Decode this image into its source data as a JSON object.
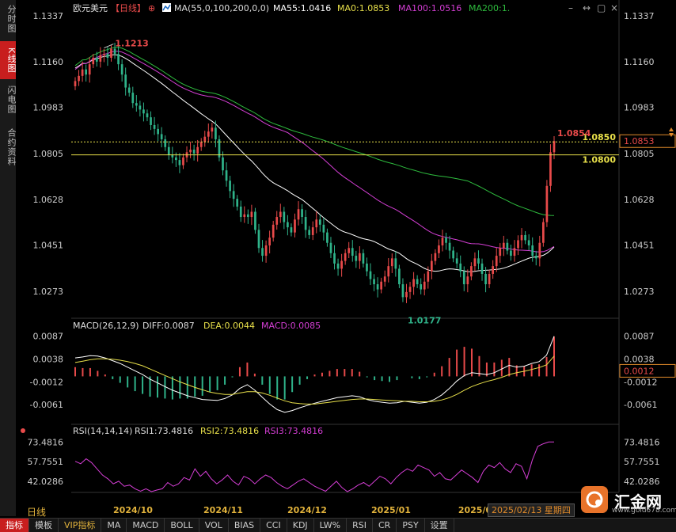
{
  "sidebar": {
    "tabs": [
      {
        "label": "分时图",
        "active": false
      },
      {
        "label": "K线图",
        "active": true
      },
      {
        "label": "闪电图",
        "active": false
      },
      {
        "label": "合约资料",
        "active": false
      }
    ]
  },
  "header": {
    "symbol": "欧元美元",
    "period": "【日线】",
    "settings_icon": "⊕",
    "ma_icon": "chart-icon",
    "ma_spec": "MA(55,0,100,200,0,0)",
    "ma55": "MA55:1.0416",
    "ma0": "MA0:1.0853",
    "ma100": "MA100:1.0516",
    "ma200": "MA200:1."
  },
  "window_controls": [
    "–",
    "↔",
    "▢",
    "×"
  ],
  "colors": {
    "up": "#e84a4a",
    "down": "#2fb38a",
    "ma55": "#ffffff",
    "ma100": "#d43ed4",
    "ma200": "#2ebc3e",
    "hline": "#e8e04a",
    "dif": "#ffffff",
    "dea": "#e8e04a",
    "rsi": "#d43ed4",
    "accent_orange": "#e08a2a"
  },
  "chart_data": [
    {
      "type": "candlestick",
      "title": "欧元美元【日线】",
      "y_ticks": [
        "1.1337",
        "1.1160",
        "1.0983",
        "1.0805",
        "1.0628",
        "1.0451",
        "1.0273"
      ],
      "ylim": [
        1.019,
        1.1337
      ],
      "x_ticks": [
        "2024/10",
        "2024/11",
        "2024/12",
        "2025/01",
        "2025/0"
      ],
      "annotations": [
        {
          "label": "1.1213",
          "value": 1.1213,
          "kind": "high"
        },
        {
          "label": "1.0177",
          "value": 1.0177,
          "kind": "low"
        }
      ],
      "horizontal_lines": [
        {
          "label": "1.0850",
          "value": 1.085
        },
        {
          "label": "1.0800",
          "value": 1.08
        }
      ],
      "last_high_label": "1.0854",
      "last_price_label": "1.0853",
      "last_price": 1.0853,
      "closes": [
        1.1085,
        1.1105,
        1.113,
        1.111,
        1.115,
        1.1175,
        1.116,
        1.1185,
        1.119,
        1.1175,
        1.121,
        1.119,
        1.115,
        1.111,
        1.106,
        1.104,
        1.1,
        1.099,
        1.0975,
        1.096,
        1.0945,
        1.0915,
        1.09,
        1.088,
        1.086,
        1.083,
        1.08,
        1.079,
        1.078,
        1.076,
        1.079,
        1.081,
        1.082,
        1.0805,
        1.083,
        1.085,
        1.087,
        1.089,
        1.0905,
        1.086,
        1.079,
        1.074,
        1.07,
        1.066,
        1.063,
        1.06,
        1.056,
        1.057,
        1.056,
        1.058,
        1.051,
        1.044,
        1.041,
        1.045,
        1.048,
        1.053,
        1.056,
        1.058,
        1.054,
        1.052,
        1.05,
        1.055,
        1.059,
        1.056,
        1.051,
        1.049,
        1.052,
        1.055,
        1.053,
        1.05,
        1.046,
        1.042,
        1.038,
        1.036,
        1.039,
        1.042,
        1.044,
        1.041,
        1.039,
        1.042,
        1.038,
        1.035,
        1.032,
        1.03,
        1.028,
        1.031,
        1.033,
        1.037,
        1.04,
        1.036,
        1.03,
        1.025,
        1.027,
        1.029,
        1.032,
        1.03,
        1.028,
        1.031,
        1.035,
        1.039,
        1.042,
        1.045,
        1.048,
        1.046,
        1.043,
        1.04,
        1.038,
        1.035,
        1.03,
        1.033,
        1.037,
        1.04,
        1.038,
        1.034,
        1.03,
        1.034,
        1.037,
        1.041,
        1.044,
        1.046,
        1.043,
        1.041,
        1.044,
        1.047,
        1.049,
        1.047,
        1.045,
        1.041,
        1.04,
        1.046,
        1.054,
        1.068,
        1.081,
        1.0853
      ]
    },
    {
      "type": "line",
      "title": "MACD(26,12,9)",
      "dif_label": "DIFF:0.0087",
      "dea_label": "DEA:0.0044",
      "macd_label": "MACD:0.0085",
      "y_ticks": [
        "0.0087",
        "0.0038",
        "-0.0012",
        "-0.0061"
      ],
      "ylim": [
        -0.0085,
        0.0095
      ],
      "cursor_label": "0.0012",
      "series": [
        {
          "name": "DIFF",
          "values": [
            0.004,
            0.0042,
            0.0045,
            0.0044,
            0.004,
            0.0034,
            0.0028,
            0.002,
            0.0012,
            0.0004,
            -0.0006,
            -0.0014,
            -0.0022,
            -0.003,
            -0.0036,
            -0.0042,
            -0.0046,
            -0.005,
            -0.0051,
            -0.0052,
            -0.0048,
            -0.004,
            -0.0026,
            -0.0018,
            -0.003,
            -0.0045,
            -0.006,
            -0.0072,
            -0.0078,
            -0.0074,
            -0.0068,
            -0.0063,
            -0.0058,
            -0.0054,
            -0.005,
            -0.0046,
            -0.0044,
            -0.0042,
            -0.0044,
            -0.005,
            -0.0054,
            -0.0056,
            -0.0058,
            -0.0057,
            -0.0054,
            -0.0056,
            -0.0058,
            -0.0056,
            -0.005,
            -0.004,
            -0.0026,
            -0.001,
            0.0002,
            0.0008,
            0.0006,
            0.0004,
            0.0008,
            0.0016,
            0.0024,
            0.002,
            0.0022,
            0.0028,
            0.0032,
            0.0046,
            0.0087
          ]
        },
        {
          "name": "DEA",
          "values": [
            0.003,
            0.0033,
            0.0036,
            0.0038,
            0.0038,
            0.0037,
            0.0035,
            0.0032,
            0.0028,
            0.0023,
            0.0016,
            0.0009,
            0.0002,
            -0.0005,
            -0.0012,
            -0.0018,
            -0.0024,
            -0.0029,
            -0.0034,
            -0.0037,
            -0.0039,
            -0.0039,
            -0.0036,
            -0.0033,
            -0.0033,
            -0.0036,
            -0.0041,
            -0.0047,
            -0.0053,
            -0.0057,
            -0.0059,
            -0.006,
            -0.006,
            -0.0058,
            -0.0056,
            -0.0054,
            -0.0052,
            -0.005,
            -0.0049,
            -0.0049,
            -0.005,
            -0.0051,
            -0.0052,
            -0.0053,
            -0.0054,
            -0.0054,
            -0.0055,
            -0.0055,
            -0.0054,
            -0.0051,
            -0.0046,
            -0.0039,
            -0.003,
            -0.0022,
            -0.0016,
            -0.0011,
            -0.0007,
            -0.0002,
            0.0004,
            0.0008,
            0.0011,
            0.0015,
            0.0019,
            0.0025,
            0.0044
          ]
        }
      ]
    },
    {
      "type": "line",
      "title": "RSI(14,14,14)",
      "rsi1_label": "RSI1:73.4816",
      "rsi2_label": "RSI2:73.4816",
      "rsi3_label": "RSI3:73.4816",
      "y_ticks": [
        "73.4816",
        "57.7551",
        "42.0286"
      ],
      "ylim": [
        28,
        80
      ],
      "series": [
        {
          "name": "RSI1",
          "values": [
            58,
            56,
            60,
            57,
            52,
            47,
            44,
            40,
            42,
            38,
            39,
            36,
            34,
            36,
            33,
            35,
            36,
            41,
            38,
            40,
            45,
            43,
            52,
            46,
            50,
            44,
            40,
            43,
            47,
            42,
            39,
            46,
            44,
            40,
            44,
            47,
            45,
            41,
            38,
            36,
            39,
            42,
            44,
            41,
            38,
            36,
            34,
            38,
            42,
            37,
            33,
            36,
            39,
            41,
            38,
            42,
            46,
            44,
            40,
            45,
            49,
            52,
            50,
            55,
            53,
            51,
            46,
            49,
            44,
            43,
            47,
            51,
            48,
            45,
            41,
            50,
            55,
            53,
            57,
            52,
            49,
            56,
            54,
            44,
            59,
            70,
            72,
            73.4816,
            73.4816
          ]
        }
      ]
    }
  ],
  "x_axis_label_cursor": "2025/02/13 星期四",
  "bottom_period": "日线",
  "bottom_tabs": [
    {
      "label": "指标",
      "active": true
    },
    {
      "label": "模板",
      "active": false
    },
    {
      "label": "VIP指标",
      "active": false,
      "vip": true
    },
    {
      "label": "MA",
      "active": false
    },
    {
      "label": "MACD",
      "active": false
    },
    {
      "label": "BOLL",
      "active": false
    },
    {
      "label": "VOL",
      "active": false
    },
    {
      "label": "BIAS",
      "active": false
    },
    {
      "label": "CCI",
      "active": false
    },
    {
      "label": "KDJ",
      "active": false
    },
    {
      "label": "LW%",
      "active": false
    },
    {
      "label": "RSI",
      "active": false
    },
    {
      "label": "CR",
      "active": false
    },
    {
      "label": "PSY",
      "active": false
    },
    {
      "label": "设置",
      "active": false
    }
  ],
  "logo": {
    "name": "汇金网",
    "url": "www.gold678.com",
    "icon": "logo-icon"
  }
}
